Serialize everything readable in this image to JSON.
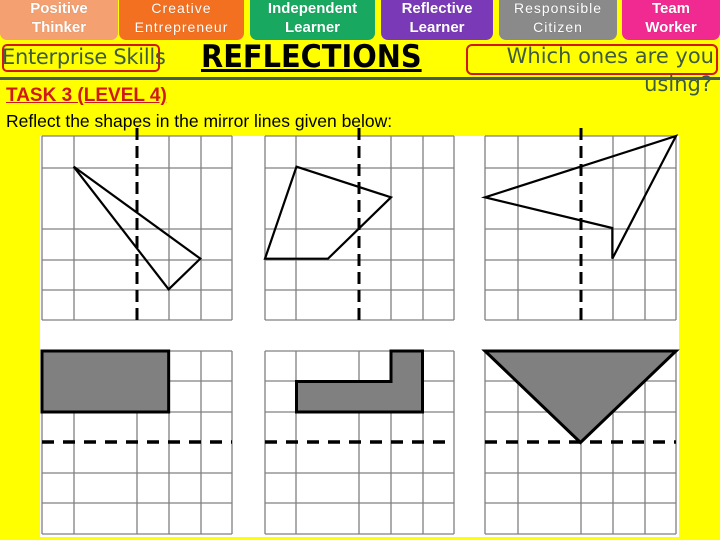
{
  "skills_tabs": [
    {
      "line1": "Positive",
      "line2": "Thinker",
      "color": "#f4a070"
    },
    {
      "line1": "Creative",
      "line2": "Entrepreneur",
      "color": "#f27020"
    },
    {
      "line1": "Independent",
      "line2": "Learner",
      "color": "#18a860"
    },
    {
      "line1": "Reflective",
      "line2": "Learner",
      "color": "#7a3ab8"
    },
    {
      "line1": "Responsible",
      "line2": "Citizen",
      "color": "#8a8a8a"
    },
    {
      "line1": "Team",
      "line2": "Worker",
      "color": "#f02a90"
    }
  ],
  "header": {
    "enterprise_label": "Enterprise Skills",
    "title": "REFLECTIONS",
    "question_line1": "Which ones are you",
    "question_line2": "using?"
  },
  "task": {
    "heading": "TASK 3 (LEVEL 4)",
    "instruction": "Reflect the shapes in the mirror lines given below:"
  },
  "colors": {
    "background": "#ffff00",
    "highlight_box": "#d01818",
    "task_heading": "#d01818",
    "shape_fill": "#808080",
    "grid_line": "#808080"
  },
  "grids": [
    {
      "name": "triangle",
      "mirror": "vertical",
      "filled": false,
      "points": [
        [
          1,
          1
        ],
        [
          5,
          4
        ],
        [
          4,
          5
        ]
      ]
    },
    {
      "name": "pentagon",
      "mirror": "vertical",
      "filled": false,
      "points": [
        [
          1,
          1
        ],
        [
          4,
          2
        ],
        [
          2,
          4
        ],
        [
          0,
          4
        ]
      ]
    },
    {
      "name": "arrow-quad",
      "mirror": "vertical",
      "filled": false,
      "points": [
        [
          6,
          0
        ],
        [
          0,
          2
        ],
        [
          4,
          3
        ],
        [
          4,
          4
        ]
      ]
    },
    {
      "name": "rectangle",
      "mirror": "horizontal",
      "filled": true,
      "points": [
        [
          0,
          0
        ],
        [
          4,
          0
        ],
        [
          4,
          2
        ],
        [
          0,
          2
        ]
      ]
    },
    {
      "name": "l-shape",
      "mirror": "horizontal",
      "filled": true,
      "points": [
        [
          1,
          1
        ],
        [
          4,
          1
        ],
        [
          4,
          0
        ],
        [
          5,
          0
        ],
        [
          5,
          2
        ],
        [
          1,
          2
        ]
      ]
    },
    {
      "name": "inverted-triangle",
      "mirror": "horizontal",
      "filled": true,
      "points": [
        [
          0,
          0
        ],
        [
          6,
          0
        ],
        [
          3,
          3
        ]
      ]
    }
  ]
}
